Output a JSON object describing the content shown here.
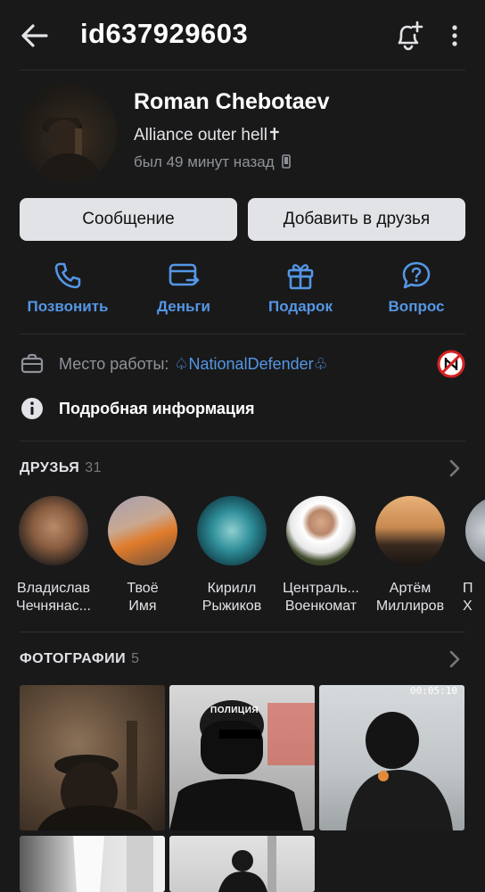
{
  "header": {
    "title": "id637929603"
  },
  "profile": {
    "name": "Roman Chebotaev",
    "status": "Alliance outer hell✝",
    "last_seen": "был 49 минут назад"
  },
  "buttons": {
    "message": "Сообщение",
    "add_friend": "Добавить в друзья"
  },
  "actions": [
    {
      "label": "Позвонить",
      "icon": "phone-icon"
    },
    {
      "label": "Деньги",
      "icon": "money-card-icon"
    },
    {
      "label": "Подарок",
      "icon": "gift-icon"
    },
    {
      "label": "Вопрос",
      "icon": "question-icon"
    }
  ],
  "work": {
    "label": "Место работы:",
    "value": "♤NationalDefender♧"
  },
  "details": {
    "label": "Подробная информация"
  },
  "friends": {
    "title": "ДРУЗЬЯ",
    "count": "31",
    "items": [
      {
        "line1": "Владислав",
        "line2": "Чечнянас..."
      },
      {
        "line1": "Твоё",
        "line2": "Имя"
      },
      {
        "line1": "Кирилл",
        "line2": "Рыжиков"
      },
      {
        "line1": "Централь...",
        "line2": "Военкомат"
      },
      {
        "line1": "Артём",
        "line2": "Миллиров"
      },
      {
        "line1": "П",
        "line2": "Х"
      }
    ]
  },
  "photos": {
    "title": "ФОТОГРАФИИ",
    "count": "5",
    "overlay_text": "ПОЛИЦИЯ",
    "timestamp": "00:05:10"
  },
  "colors": {
    "background": "#19191a",
    "accent": "#5496e4",
    "button_bg": "#e1e3e6"
  }
}
